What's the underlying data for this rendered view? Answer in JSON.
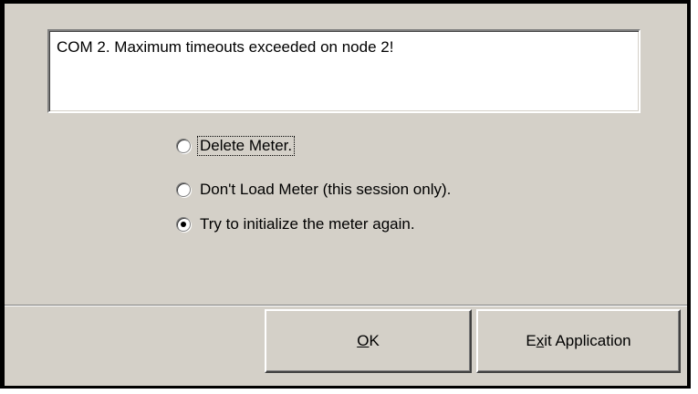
{
  "dialog": {
    "message": "COM 2. Maximum timeouts exceeded on node 2!",
    "options": [
      {
        "label": "Delete Meter.",
        "selected": false
      },
      {
        "label": "Don't Load Meter (this session only).",
        "selected": false
      },
      {
        "label": "Try to initialize the meter again.",
        "selected": true
      }
    ]
  },
  "buttons": {
    "ok": {
      "label": "OK",
      "mnemonic": "O",
      "rest": "K"
    },
    "exit": {
      "label": "Exit Application",
      "pre": "E",
      "mnemonic": "x",
      "rest": "it Application"
    }
  }
}
